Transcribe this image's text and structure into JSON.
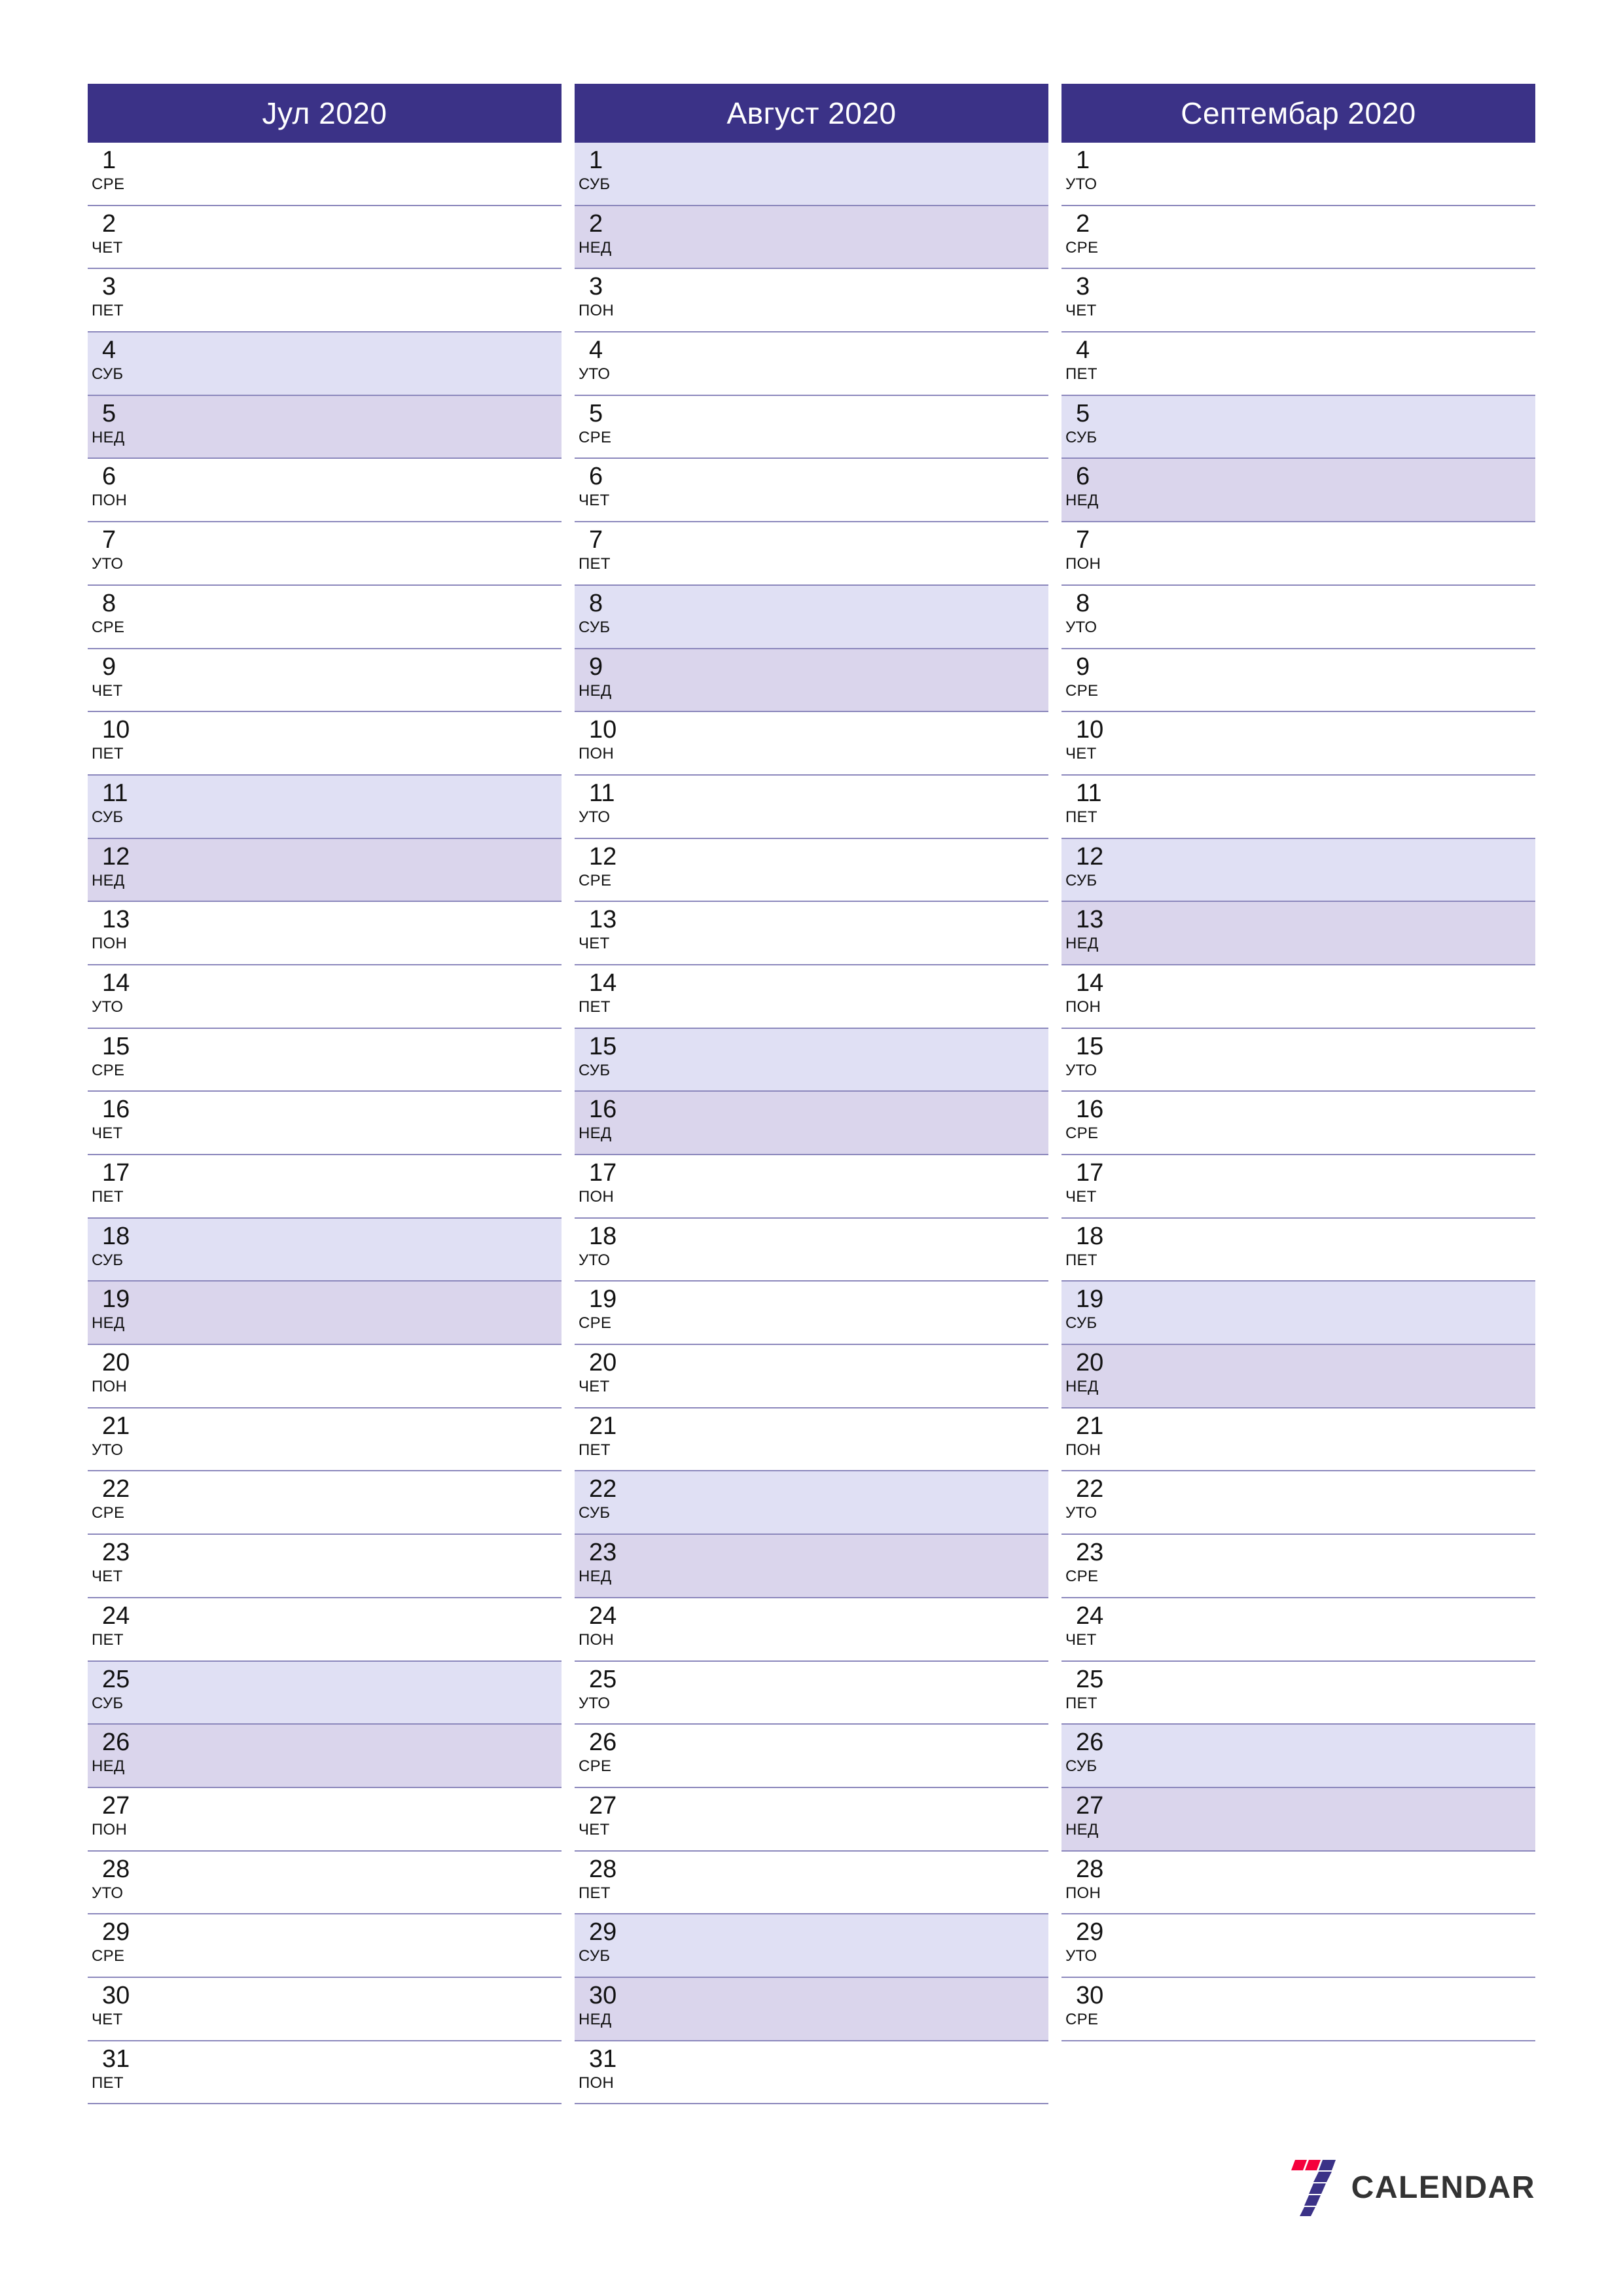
{
  "brand": {
    "name": "CALENDAR",
    "mark_name": "seven-logo-mark",
    "colors": {
      "accent_red": "#F5003C",
      "accent_indigo": "#3B3287",
      "text": "#333333"
    }
  },
  "theme": {
    "header_bg": "#3B3287",
    "header_text": "#FFFFFF",
    "saturday_bg": "#E0E0F4",
    "sunday_bg": "#DAD5EC",
    "row_divider": "#8B87BC",
    "page_bg": "#FFFFFF",
    "day_text": "#121212"
  },
  "weekday_labels": {
    "mon": "ПОН",
    "tue": "УТО",
    "wed": "СРЕ",
    "thu": "ЧЕТ",
    "fri": "ПЕТ",
    "sat": "СУБ",
    "sun": "НЕД"
  },
  "months": [
    {
      "title": "Јул 2020",
      "days": [
        {
          "num": "1",
          "wd": "СРЕ",
          "type": "weekday"
        },
        {
          "num": "2",
          "wd": "ЧЕТ",
          "type": "weekday"
        },
        {
          "num": "3",
          "wd": "ПЕТ",
          "type": "weekday"
        },
        {
          "num": "4",
          "wd": "СУБ",
          "type": "sat"
        },
        {
          "num": "5",
          "wd": "НЕД",
          "type": "sun"
        },
        {
          "num": "6",
          "wd": "ПОН",
          "type": "weekday"
        },
        {
          "num": "7",
          "wd": "УТО",
          "type": "weekday"
        },
        {
          "num": "8",
          "wd": "СРЕ",
          "type": "weekday"
        },
        {
          "num": "9",
          "wd": "ЧЕТ",
          "type": "weekday"
        },
        {
          "num": "10",
          "wd": "ПЕТ",
          "type": "weekday"
        },
        {
          "num": "11",
          "wd": "СУБ",
          "type": "sat"
        },
        {
          "num": "12",
          "wd": "НЕД",
          "type": "sun"
        },
        {
          "num": "13",
          "wd": "ПОН",
          "type": "weekday"
        },
        {
          "num": "14",
          "wd": "УТО",
          "type": "weekday"
        },
        {
          "num": "15",
          "wd": "СРЕ",
          "type": "weekday"
        },
        {
          "num": "16",
          "wd": "ЧЕТ",
          "type": "weekday"
        },
        {
          "num": "17",
          "wd": "ПЕТ",
          "type": "weekday"
        },
        {
          "num": "18",
          "wd": "СУБ",
          "type": "sat"
        },
        {
          "num": "19",
          "wd": "НЕД",
          "type": "sun"
        },
        {
          "num": "20",
          "wd": "ПОН",
          "type": "weekday"
        },
        {
          "num": "21",
          "wd": "УТО",
          "type": "weekday"
        },
        {
          "num": "22",
          "wd": "СРЕ",
          "type": "weekday"
        },
        {
          "num": "23",
          "wd": "ЧЕТ",
          "type": "weekday"
        },
        {
          "num": "24",
          "wd": "ПЕТ",
          "type": "weekday"
        },
        {
          "num": "25",
          "wd": "СУБ",
          "type": "sat"
        },
        {
          "num": "26",
          "wd": "НЕД",
          "type": "sun"
        },
        {
          "num": "27",
          "wd": "ПОН",
          "type": "weekday"
        },
        {
          "num": "28",
          "wd": "УТО",
          "type": "weekday"
        },
        {
          "num": "29",
          "wd": "СРЕ",
          "type": "weekday"
        },
        {
          "num": "30",
          "wd": "ЧЕТ",
          "type": "weekday"
        },
        {
          "num": "31",
          "wd": "ПЕТ",
          "type": "weekday"
        }
      ]
    },
    {
      "title": "Август 2020",
      "days": [
        {
          "num": "1",
          "wd": "СУБ",
          "type": "sat"
        },
        {
          "num": "2",
          "wd": "НЕД",
          "type": "sun"
        },
        {
          "num": "3",
          "wd": "ПОН",
          "type": "weekday"
        },
        {
          "num": "4",
          "wd": "УТО",
          "type": "weekday"
        },
        {
          "num": "5",
          "wd": "СРЕ",
          "type": "weekday"
        },
        {
          "num": "6",
          "wd": "ЧЕТ",
          "type": "weekday"
        },
        {
          "num": "7",
          "wd": "ПЕТ",
          "type": "weekday"
        },
        {
          "num": "8",
          "wd": "СУБ",
          "type": "sat"
        },
        {
          "num": "9",
          "wd": "НЕД",
          "type": "sun"
        },
        {
          "num": "10",
          "wd": "ПОН",
          "type": "weekday"
        },
        {
          "num": "11",
          "wd": "УТО",
          "type": "weekday"
        },
        {
          "num": "12",
          "wd": "СРЕ",
          "type": "weekday"
        },
        {
          "num": "13",
          "wd": "ЧЕТ",
          "type": "weekday"
        },
        {
          "num": "14",
          "wd": "ПЕТ",
          "type": "weekday"
        },
        {
          "num": "15",
          "wd": "СУБ",
          "type": "sat"
        },
        {
          "num": "16",
          "wd": "НЕД",
          "type": "sun"
        },
        {
          "num": "17",
          "wd": "ПОН",
          "type": "weekday"
        },
        {
          "num": "18",
          "wd": "УТО",
          "type": "weekday"
        },
        {
          "num": "19",
          "wd": "СРЕ",
          "type": "weekday"
        },
        {
          "num": "20",
          "wd": "ЧЕТ",
          "type": "weekday"
        },
        {
          "num": "21",
          "wd": "ПЕТ",
          "type": "weekday"
        },
        {
          "num": "22",
          "wd": "СУБ",
          "type": "sat"
        },
        {
          "num": "23",
          "wd": "НЕД",
          "type": "sun"
        },
        {
          "num": "24",
          "wd": "ПОН",
          "type": "weekday"
        },
        {
          "num": "25",
          "wd": "УТО",
          "type": "weekday"
        },
        {
          "num": "26",
          "wd": "СРЕ",
          "type": "weekday"
        },
        {
          "num": "27",
          "wd": "ЧЕТ",
          "type": "weekday"
        },
        {
          "num": "28",
          "wd": "ПЕТ",
          "type": "weekday"
        },
        {
          "num": "29",
          "wd": "СУБ",
          "type": "sat"
        },
        {
          "num": "30",
          "wd": "НЕД",
          "type": "sun"
        },
        {
          "num": "31",
          "wd": "ПОН",
          "type": "weekday"
        }
      ]
    },
    {
      "title": "Септембар 2020",
      "days": [
        {
          "num": "1",
          "wd": "УТО",
          "type": "weekday"
        },
        {
          "num": "2",
          "wd": "СРЕ",
          "type": "weekday"
        },
        {
          "num": "3",
          "wd": "ЧЕТ",
          "type": "weekday"
        },
        {
          "num": "4",
          "wd": "ПЕТ",
          "type": "weekday"
        },
        {
          "num": "5",
          "wd": "СУБ",
          "type": "sat"
        },
        {
          "num": "6",
          "wd": "НЕД",
          "type": "sun"
        },
        {
          "num": "7",
          "wd": "ПОН",
          "type": "weekday"
        },
        {
          "num": "8",
          "wd": "УТО",
          "type": "weekday"
        },
        {
          "num": "9",
          "wd": "СРЕ",
          "type": "weekday"
        },
        {
          "num": "10",
          "wd": "ЧЕТ",
          "type": "weekday"
        },
        {
          "num": "11",
          "wd": "ПЕТ",
          "type": "weekday"
        },
        {
          "num": "12",
          "wd": "СУБ",
          "type": "sat"
        },
        {
          "num": "13",
          "wd": "НЕД",
          "type": "sun"
        },
        {
          "num": "14",
          "wd": "ПОН",
          "type": "weekday"
        },
        {
          "num": "15",
          "wd": "УТО",
          "type": "weekday"
        },
        {
          "num": "16",
          "wd": "СРЕ",
          "type": "weekday"
        },
        {
          "num": "17",
          "wd": "ЧЕТ",
          "type": "weekday"
        },
        {
          "num": "18",
          "wd": "ПЕТ",
          "type": "weekday"
        },
        {
          "num": "19",
          "wd": "СУБ",
          "type": "sat"
        },
        {
          "num": "20",
          "wd": "НЕД",
          "type": "sun"
        },
        {
          "num": "21",
          "wd": "ПОН",
          "type": "weekday"
        },
        {
          "num": "22",
          "wd": "УТО",
          "type": "weekday"
        },
        {
          "num": "23",
          "wd": "СРЕ",
          "type": "weekday"
        },
        {
          "num": "24",
          "wd": "ЧЕТ",
          "type": "weekday"
        },
        {
          "num": "25",
          "wd": "ПЕТ",
          "type": "weekday"
        },
        {
          "num": "26",
          "wd": "СУБ",
          "type": "sat"
        },
        {
          "num": "27",
          "wd": "НЕД",
          "type": "sun"
        },
        {
          "num": "28",
          "wd": "ПОН",
          "type": "weekday"
        },
        {
          "num": "29",
          "wd": "УТО",
          "type": "weekday"
        },
        {
          "num": "30",
          "wd": "СРЕ",
          "type": "weekday"
        }
      ]
    }
  ]
}
